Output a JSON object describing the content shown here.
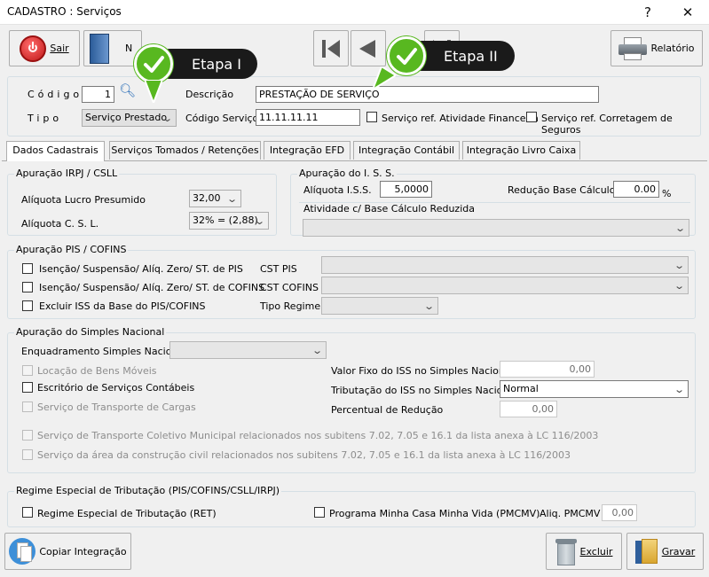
{
  "window": {
    "title": "CADASTRO : Serviços",
    "help": "?",
    "close": "✕"
  },
  "toolbar": {
    "sair": "Sair",
    "novo": "N",
    "relatorio": "Relatório"
  },
  "annotations": {
    "etapa1": "Etapa I",
    "etapa2": "Etapa II"
  },
  "header": {
    "codigo_label": "Código",
    "codigo_value": "1",
    "descricao_label": "Descrição",
    "descricao_value": "PRESTAÇÃO DE SERVIÇO",
    "tipo_label": "Tipo",
    "tipo_value": "Serviço Prestado",
    "codigo_servico_label": "Código Serviço",
    "codigo_servico_value": "11.11.11.11",
    "ref_fin_label": "Serviço ref. Atividade Financeira",
    "ref_seg_label": "Serviço ref. Corretagem de Seguros"
  },
  "tabs": [
    "Dados Cadastrais",
    "Serviços Tomados / Retenções",
    "Integração EFD",
    "Integração Contábil",
    "Integração Livro Caixa"
  ],
  "irpj": {
    "title": "Apuração IRPJ / CSLL",
    "lucro_label": "Alíquota Lucro Presumido",
    "lucro_value": "32,00",
    "csl_label": "Alíquota C. S. L.",
    "csl_value": "32% = (2,88)"
  },
  "iss": {
    "title": "Apuração do I. S. S.",
    "aliquota_label": "Alíquota I.S.S.",
    "aliquota_value": "5,0000",
    "reducao_label": "Redução Base Cálculo",
    "reducao_value": "0.00",
    "reducao_unit": "%",
    "atividade_label": "Atividade c/ Base Cálculo Reduzida"
  },
  "pis": {
    "title": "Apuração PIS / COFINS",
    "isencao_pis": "Isenção/ Suspensão/ Alíq. Zero/ ST. de PIS",
    "isencao_cofins": "Isenção/ Suspensão/ Alíq. Zero/ ST. de COFINS",
    "excluir_iss": "Excluir ISS da Base do PIS/COFINS",
    "cst_pis": "CST PIS",
    "cst_cofins": "CST COFINS",
    "tipo_regime": "Tipo Regime"
  },
  "simples": {
    "title": "Apuração do Simples Nacional",
    "enquadramento_label": "Enquadramento Simples Nacional",
    "locacao": "Locação de Bens Móveis",
    "escritorio": "Escritório de Serviços Contábeis",
    "transporte_cargas": "Serviço de Transporte de Cargas",
    "valor_fixo_label": "Valor Fixo do ISS no Simples Nacional",
    "valor_fixo_value": "0,00",
    "tributacao_label": "Tributação do ISS no Simples Nacional",
    "tributacao_value": "Normal",
    "percentual_label": "Percentual de Redução",
    "percentual_value": "0,00",
    "transporte_coletivo": "Serviço de Transporte Coletivo Municipal relacionados nos subitens 7.02, 7.05 e 16.1 da lista anexa à LC 116/2003",
    "construcao": "Serviço da área da construção civil relacionados nos subitens 7.02, 7.05 e 16.1 da lista anexa à LC 116/2003"
  },
  "regime": {
    "title": "Regime Especial de Tributação (PIS/COFINS/CSLL/IRPJ)",
    "ret_label": "Regime Especial de Tributação (RET)",
    "pmcmv_label": "Programa Minha Casa Minha Vida (PMCMV)",
    "aliq_label": "Aliq. PMCMV",
    "aliq_value": "0,00"
  },
  "footer": {
    "copiar": "Copiar Integração",
    "excluir": "Excluir",
    "gravar": "Gravar"
  },
  "colors": {
    "accent_green": "#58b820",
    "badge_dark": "#1a1a1a"
  }
}
